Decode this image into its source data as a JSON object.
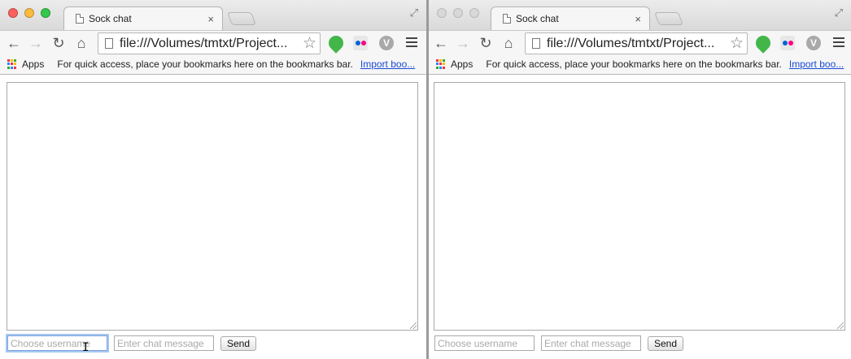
{
  "windows": [
    {
      "id": "left",
      "active": true,
      "tab": {
        "title": "Sock chat",
        "close": "×"
      },
      "url": "file:///Volumes/tmtxt/Project...",
      "bookmarks": {
        "apps_label": "Apps",
        "hint": "For quick access, place your bookmarks here on the bookmarks bar.",
        "import_link": "Import boo..."
      },
      "form": {
        "username_placeholder": "Choose username",
        "message_placeholder": "Enter chat message",
        "send_label": "Send"
      }
    },
    {
      "id": "right",
      "active": false,
      "tab": {
        "title": "Sock chat",
        "close": "×"
      },
      "url": "file:///Volumes/tmtxt/Project...",
      "bookmarks": {
        "apps_label": "Apps",
        "hint": "For quick access, place your bookmarks here on the bookmarks bar.",
        "import_link": "Import boo..."
      },
      "form": {
        "username_placeholder": "Choose username",
        "message_placeholder": "Enter chat message",
        "send_label": "Send"
      }
    }
  ],
  "icons": {
    "back": "←",
    "forward": "→",
    "reload": "↻",
    "home": "⌂",
    "star": "☆",
    "fullscreen": "⤢",
    "ibeam": "I"
  },
  "colors": {
    "link": "#1a4bd6",
    "focus_ring": "#a8c7f0",
    "evernote": "#43b649",
    "flickr_pink": "#ff0084",
    "flickr_blue": "#0063dc"
  }
}
